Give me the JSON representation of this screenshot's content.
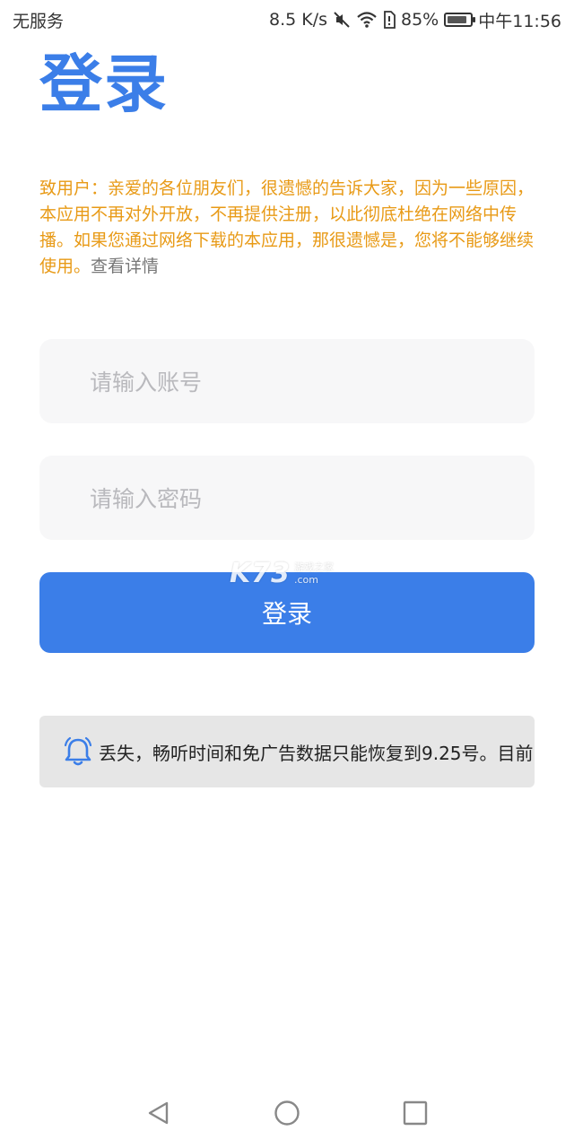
{
  "status_bar": {
    "carrier": "无服务",
    "speed": "8.5 K/s",
    "battery_percent": "85%",
    "battery_level": 0.85,
    "time": "中午11:56"
  },
  "page": {
    "title": "登录"
  },
  "notice": {
    "text": "致用户：亲爱的各位朋友们，很遗憾的告诉大家，因为一些原因，本应用不再对外开放，不再提供注册，以此彻底杜绝在网络中传播。如果您通过网络下载的本应用，那很遗憾是，您将不能够继续使用。",
    "link_label": "查看详情",
    "color": "#e89a16"
  },
  "form": {
    "account_placeholder": "请输入账号",
    "account_value": "",
    "password_placeholder": "请输入密码",
    "password_value": "",
    "login_label": "登录",
    "accent": "#3b7ee8"
  },
  "watermark": {
    "main": "K73",
    "sub_top": "游戏之家",
    "sub_bottom": ".com"
  },
  "announcement": {
    "icon": "bell-icon",
    "text": "丢失，畅听时间和免广告数据只能恢复到9.25号。目前"
  },
  "nav_bar": {
    "back_icon": "triangle-back-icon",
    "home_icon": "circle-home-icon",
    "recent_icon": "square-recent-icon"
  }
}
